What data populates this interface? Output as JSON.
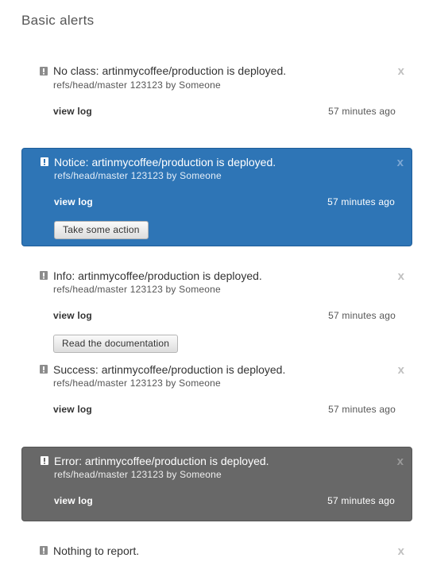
{
  "page": {
    "title": "Basic alerts"
  },
  "alerts": [
    {
      "title": "No class: artinmycoffee/production is deployed.",
      "meta": "refs/head/master 123123 by Someone",
      "link": "view log",
      "time": "57 minutes ago",
      "close": "x"
    },
    {
      "title": "Notice: artinmycoffee/production is deployed.",
      "meta": "refs/head/master 123123 by Someone",
      "link": "view log",
      "time": "57 minutes ago",
      "close": "x",
      "button": "Take some action"
    },
    {
      "title": "Info: artinmycoffee/production is deployed.",
      "meta": "refs/head/master 123123 by Someone",
      "link": "view log",
      "time": "57 minutes ago",
      "close": "x",
      "button": "Read the documentation"
    },
    {
      "title": "Success: artinmycoffee/production is deployed.",
      "meta": "refs/head/master 123123 by Someone",
      "link": "view log",
      "time": "57 minutes ago",
      "close": "x"
    },
    {
      "title": "Error: artinmycoffee/production is deployed.",
      "meta": "refs/head/master 123123 by Someone",
      "link": "view log",
      "time": "57 minutes ago",
      "close": "x"
    },
    {
      "title": "Nothing to report.",
      "close": "x"
    }
  ],
  "icons": {
    "alert": "exclamation-icon",
    "close": "close-icon"
  },
  "colors": {
    "notice": "#2e75b6",
    "error": "#686868",
    "close_muted": "#c0c0c0"
  }
}
